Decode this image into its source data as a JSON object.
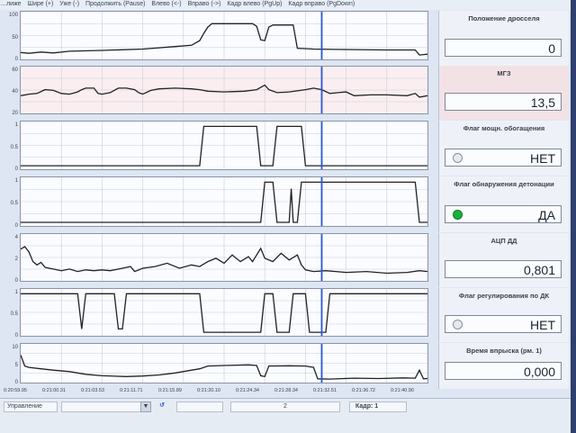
{
  "menu": [
    "…лиже",
    "Шире (+)",
    "Уже (-)",
    "Продолжить (Pause)",
    "Влево (<-)",
    "Вправо (->)",
    "Кадр влево (PgUp)",
    "Кадр вправо (PgDown)"
  ],
  "charts": [
    {
      "name": "throttle",
      "yticks": [
        "100",
        "50",
        "0"
      ],
      "ymin": 0,
      "ymax": 100,
      "highlight": false,
      "series": [
        [
          0,
          10
        ],
        [
          0.02,
          8
        ],
        [
          0.05,
          11
        ],
        [
          0.08,
          9
        ],
        [
          0.12,
          13
        ],
        [
          0.2,
          15
        ],
        [
          0.3,
          18
        ],
        [
          0.38,
          24
        ],
        [
          0.42,
          27
        ],
        [
          0.44,
          38
        ],
        [
          0.45,
          55
        ],
        [
          0.46,
          70
        ],
        [
          0.47,
          78
        ],
        [
          0.57,
          78
        ],
        [
          0.58,
          72
        ],
        [
          0.59,
          40
        ],
        [
          0.6,
          38
        ],
        [
          0.61,
          70
        ],
        [
          0.62,
          75
        ],
        [
          0.67,
          75
        ],
        [
          0.68,
          20
        ],
        [
          0.72,
          18
        ],
        [
          0.8,
          17
        ],
        [
          0.9,
          16
        ],
        [
          0.97,
          16
        ],
        [
          0.98,
          4
        ],
        [
          1,
          6
        ]
      ]
    },
    {
      "name": "mgz",
      "yticks": [
        "60",
        "40",
        "20"
      ],
      "ymin": 10,
      "ymax": 65,
      "highlight": true,
      "series": [
        [
          0,
          30
        ],
        [
          0.02,
          32
        ],
        [
          0.04,
          33
        ],
        [
          0.06,
          38
        ],
        [
          0.08,
          37
        ],
        [
          0.1,
          33
        ],
        [
          0.12,
          32
        ],
        [
          0.14,
          35
        ],
        [
          0.15,
          38
        ],
        [
          0.16,
          40
        ],
        [
          0.18,
          40
        ],
        [
          0.19,
          33
        ],
        [
          0.2,
          32
        ],
        [
          0.22,
          34
        ],
        [
          0.24,
          40
        ],
        [
          0.26,
          40
        ],
        [
          0.28,
          38
        ],
        [
          0.29,
          34
        ],
        [
          0.3,
          32
        ],
        [
          0.32,
          37
        ],
        [
          0.34,
          39
        ],
        [
          0.38,
          40
        ],
        [
          0.42,
          39
        ],
        [
          0.44,
          38
        ],
        [
          0.46,
          36
        ],
        [
          0.5,
          35
        ],
        [
          0.55,
          36
        ],
        [
          0.58,
          38
        ],
        [
          0.6,
          44
        ],
        [
          0.61,
          38
        ],
        [
          0.63,
          34
        ],
        [
          0.66,
          35
        ],
        [
          0.7,
          38
        ],
        [
          0.72,
          40
        ],
        [
          0.74,
          38
        ],
        [
          0.76,
          33
        ],
        [
          0.78,
          34
        ],
        [
          0.8,
          35
        ],
        [
          0.82,
          30
        ],
        [
          0.86,
          31
        ],
        [
          0.9,
          31
        ],
        [
          0.95,
          30
        ],
        [
          0.97,
          33
        ],
        [
          0.98,
          28
        ],
        [
          1,
          30
        ]
      ]
    },
    {
      "name": "rich-flag",
      "yticks": [
        "1",
        "0.5",
        "0"
      ],
      "ymin": 0,
      "ymax": 1,
      "highlight": false,
      "series": [
        [
          0,
          0.02
        ],
        [
          0.44,
          0.02
        ],
        [
          0.45,
          0.95
        ],
        [
          0.58,
          0.95
        ],
        [
          0.59,
          0.02
        ],
        [
          0.62,
          0.02
        ],
        [
          0.63,
          0.95
        ],
        [
          0.69,
          0.95
        ],
        [
          0.7,
          0.02
        ],
        [
          1,
          0.02
        ]
      ]
    },
    {
      "name": "knock-flag",
      "yticks": [
        "1",
        "0.5",
        "0"
      ],
      "ymin": 0,
      "ymax": 1,
      "highlight": false,
      "series": [
        [
          0,
          0.02
        ],
        [
          0.59,
          0.02
        ],
        [
          0.6,
          0.95
        ],
        [
          0.62,
          0.95
        ],
        [
          0.63,
          0.02
        ],
        [
          0.66,
          0.02
        ],
        [
          0.665,
          0.8
        ],
        [
          0.67,
          0.02
        ],
        [
          0.68,
          0.02
        ],
        [
          0.69,
          0.95
        ],
        [
          0.97,
          0.95
        ],
        [
          0.98,
          0.02
        ],
        [
          1,
          0.02
        ]
      ]
    },
    {
      "name": "adc-dd",
      "yticks": [
        "4",
        "2",
        "0"
      ],
      "ymin": 0,
      "ymax": 5,
      "highlight": false,
      "series": [
        [
          0,
          3.5
        ],
        [
          0.01,
          3.8
        ],
        [
          0.02,
          3.2
        ],
        [
          0.03,
          2
        ],
        [
          0.04,
          1.6
        ],
        [
          0.05,
          1.9
        ],
        [
          0.06,
          1.3
        ],
        [
          0.08,
          1.1
        ],
        [
          0.1,
          0.9
        ],
        [
          0.12,
          1.1
        ],
        [
          0.14,
          0.8
        ],
        [
          0.16,
          1
        ],
        [
          0.18,
          0.9
        ],
        [
          0.2,
          1
        ],
        [
          0.22,
          0.9
        ],
        [
          0.25,
          1.2
        ],
        [
          0.27,
          1.4
        ],
        [
          0.28,
          0.8
        ],
        [
          0.3,
          1.2
        ],
        [
          0.33,
          1.4
        ],
        [
          0.36,
          1.8
        ],
        [
          0.39,
          1.2
        ],
        [
          0.42,
          1.6
        ],
        [
          0.44,
          1.4
        ],
        [
          0.46,
          2
        ],
        [
          0.48,
          2.4
        ],
        [
          0.5,
          1.8
        ],
        [
          0.52,
          2.8
        ],
        [
          0.54,
          2
        ],
        [
          0.56,
          2.6
        ],
        [
          0.57,
          2
        ],
        [
          0.59,
          3.6
        ],
        [
          0.6,
          2.4
        ],
        [
          0.62,
          2
        ],
        [
          0.64,
          3
        ],
        [
          0.66,
          2.2
        ],
        [
          0.68,
          2.8
        ],
        [
          0.69,
          1.6
        ],
        [
          0.7,
          1
        ],
        [
          0.72,
          0.8
        ],
        [
          0.75,
          0.9
        ],
        [
          0.8,
          0.7
        ],
        [
          0.85,
          0.8
        ],
        [
          0.9,
          0.6
        ],
        [
          0.95,
          0.7
        ],
        [
          0.98,
          0.9
        ],
        [
          1,
          0.8
        ]
      ]
    },
    {
      "name": "regulation-flag",
      "yticks": [
        "1",
        "0.5",
        "0"
      ],
      "ymin": 0,
      "ymax": 1,
      "highlight": false,
      "series": [
        [
          0,
          0.95
        ],
        [
          0.14,
          0.95
        ],
        [
          0.15,
          0.1
        ],
        [
          0.16,
          0.95
        ],
        [
          0.23,
          0.95
        ],
        [
          0.24,
          0.1
        ],
        [
          0.25,
          0.1
        ],
        [
          0.26,
          0.95
        ],
        [
          0.44,
          0.95
        ],
        [
          0.45,
          0.02
        ],
        [
          0.59,
          0.02
        ],
        [
          0.6,
          0.95
        ],
        [
          0.62,
          0.95
        ],
        [
          0.63,
          0.02
        ],
        [
          0.66,
          0.02
        ],
        [
          0.67,
          0.95
        ],
        [
          0.7,
          0.95
        ],
        [
          0.71,
          0.02
        ],
        [
          0.75,
          0.02
        ],
        [
          0.76,
          0.95
        ],
        [
          1,
          0.95
        ]
      ]
    },
    {
      "name": "injection-time",
      "yticks": [
        "10",
        "5",
        "0"
      ],
      "ymin": 0,
      "ymax": 12,
      "highlight": false,
      "series": [
        [
          0,
          9
        ],
        [
          0.01,
          5
        ],
        [
          0.02,
          4.5
        ],
        [
          0.05,
          4
        ],
        [
          0.08,
          3.5
        ],
        [
          0.12,
          3
        ],
        [
          0.16,
          2
        ],
        [
          0.2,
          1.5
        ],
        [
          0.26,
          1.2
        ],
        [
          0.3,
          1.4
        ],
        [
          0.34,
          1.8
        ],
        [
          0.38,
          2.5
        ],
        [
          0.42,
          3.5
        ],
        [
          0.44,
          4
        ],
        [
          0.46,
          5
        ],
        [
          0.5,
          5.2
        ],
        [
          0.56,
          5.4
        ],
        [
          0.58,
          5.2
        ],
        [
          0.59,
          1.5
        ],
        [
          0.6,
          1.2
        ],
        [
          0.61,
          5
        ],
        [
          0.66,
          5.1
        ],
        [
          0.7,
          5
        ],
        [
          0.72,
          4.5
        ],
        [
          0.73,
          0.4
        ],
        [
          0.76,
          0.3
        ],
        [
          0.82,
          0.6
        ],
        [
          0.88,
          0.5
        ],
        [
          0.94,
          0.7
        ],
        [
          0.97,
          0.6
        ],
        [
          0.98,
          3.5
        ],
        [
          0.99,
          0.4
        ],
        [
          1,
          0.5
        ]
      ]
    }
  ],
  "panels": [
    {
      "title": "Положение дросселя",
      "value": "0",
      "pink": false
    },
    {
      "title": "МГЗ",
      "value": "13,5",
      "pink": true
    },
    {
      "title": "Флаг мощн. обогащения",
      "value": "НЕТ",
      "pink": false,
      "led": false
    },
    {
      "title": "Флаг обнаружения детонации",
      "value": "ДА",
      "pink": false,
      "led": true
    },
    {
      "title": "АЦП ДД",
      "value": "0,801",
      "pink": false
    },
    {
      "title": "Флаг регулирования по ДК",
      "value": "НЕТ",
      "pink": false,
      "led": false
    },
    {
      "title": "Время впрыска (рм. 1)",
      "value": "0,000",
      "pink": false
    }
  ],
  "xticks": [
    "0:20:59.95",
    "0:21:00.31",
    "0:21:03.53",
    "0:21:11.71",
    "0:21:15.89",
    "0:21:20.10",
    "0:21:24.34",
    "0:21:28.34",
    "0:21:32.51",
    "0:21:36.72",
    "0:21:40.90"
  ],
  "cursor_fraction": 0.74,
  "status": {
    "left_label": "Управление",
    "count_value": "2",
    "frame_label": "Кадр: 1"
  },
  "colors": {
    "line": "#222222",
    "cursor": "#2a56d8",
    "led_on": "#17b23a"
  }
}
